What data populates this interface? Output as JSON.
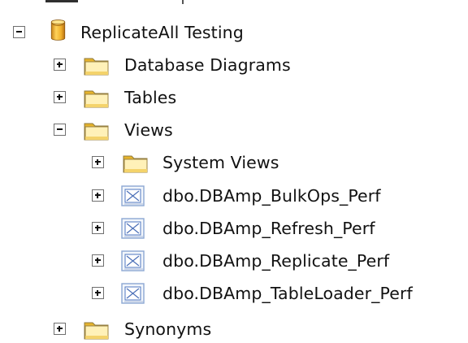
{
  "tree": {
    "database": {
      "label": "ReplicateAll Testing",
      "icon": "database-icon",
      "state": "expanded"
    },
    "folders": [
      {
        "label": "Database Diagrams",
        "icon": "folder-icon",
        "state": "collapsed"
      },
      {
        "label": "Tables",
        "icon": "folder-icon",
        "state": "collapsed"
      },
      {
        "label": "Views",
        "icon": "folder-icon",
        "state": "expanded"
      }
    ],
    "views": {
      "system_views": {
        "label": "System Views",
        "icon": "folder-icon",
        "state": "collapsed"
      },
      "items": [
        {
          "label": "dbo.DBAmp_BulkOps_Perf",
          "icon": "view-icon",
          "state": "collapsed"
        },
        {
          "label": "dbo.DBAmp_Refresh_Perf",
          "icon": "view-icon",
          "state": "collapsed"
        },
        {
          "label": "dbo.DBAmp_Replicate_Perf",
          "icon": "view-icon",
          "state": "collapsed"
        },
        {
          "label": "dbo.DBAmp_TableLoader_Perf",
          "icon": "view-icon",
          "state": "collapsed"
        }
      ]
    },
    "synonyms": {
      "label": "Synonyms",
      "icon": "folder-icon",
      "state": "collapsed"
    }
  },
  "colors": {
    "folder_light": "#fff4b8",
    "folder_dark": "#d8a516",
    "database_gold": "#f0b92d",
    "database_shadow": "#c7871b",
    "view_blue": "#4d78c9",
    "toggle_border": "#6f6f6f"
  }
}
